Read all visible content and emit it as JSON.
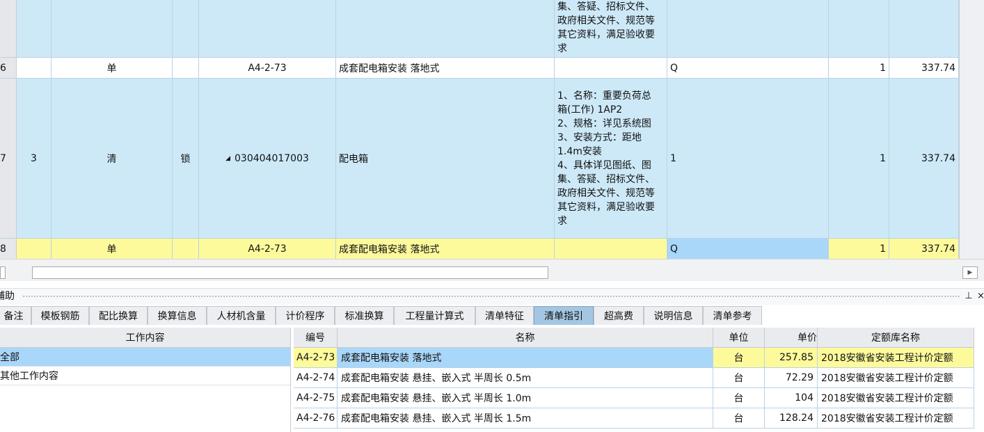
{
  "grid": {
    "rows": [
      {
        "row_no": "",
        "seq": "",
        "type": "",
        "lock": "",
        "code": "",
        "name": "",
        "feature": [
          "集、答疑、招标文件、",
          "政府相关文件、规范等",
          "其它资料，满足验收要",
          "求"
        ],
        "qty_expr": "",
        "qty": "",
        "price": "",
        "style": "blue"
      },
      {
        "row_no": "6",
        "seq": "",
        "type": "单",
        "lock": "",
        "code": "A4-2-73",
        "name": "成套配电箱安装 落地式",
        "feature": [],
        "qty_expr": "Q",
        "qty": "1",
        "price": "337.74",
        "style": "white"
      },
      {
        "row_no": "7",
        "seq": "3",
        "type": "清",
        "lock": "锁",
        "code": "030404017003",
        "name": "配电箱",
        "feature": [
          "1、名称：重要负荷总",
          "箱(工作) 1AP2",
          "2、规格：详见系统图",
          "3、安装方式：距地",
          "1.4m安装",
          "4、具体详见图纸、图",
          "集、答疑、招标文件、",
          "政府相关文件、规范等",
          "其它资料，满足验收要",
          "求"
        ],
        "qty_expr": "1",
        "qty": "1",
        "price": "337.74",
        "style": "blue"
      },
      {
        "row_no": "8",
        "seq": "",
        "type": "单",
        "lock": "",
        "code": "A4-2-73",
        "name": "成套配电箱安装 落地式",
        "feature": [],
        "qty_expr": "Q",
        "qty": "1",
        "price": "337.74",
        "style": "yellow"
      }
    ]
  },
  "aux_panel": {
    "title": "辅助",
    "pin_icon": "pin-icon",
    "close_icon": "close-icon"
  },
  "tabs": [
    {
      "label": "备注"
    },
    {
      "label": "模板钢筋"
    },
    {
      "label": "配比换算"
    },
    {
      "label": "换算信息"
    },
    {
      "label": "人材机含量"
    },
    {
      "label": "计价程序"
    },
    {
      "label": "标准换算"
    },
    {
      "label": "工程量计算式"
    },
    {
      "label": "清单特征"
    },
    {
      "label": "清单指引",
      "active": true
    },
    {
      "label": "超高费"
    },
    {
      "label": "说明信息"
    },
    {
      "label": "清单参考"
    }
  ],
  "work_content": {
    "header": "工作内容",
    "items": [
      "全部",
      "其他工作内容"
    ]
  },
  "ref_table": {
    "headers": [
      "编号",
      "名称",
      "单位",
      "单价",
      "定额库名称"
    ],
    "rows": [
      {
        "code": "A4-2-73",
        "name": "成套配电箱安装 落地式",
        "unit": "台",
        "price": "257.85",
        "lib": "2018安徽省安装工程计价定额"
      },
      {
        "code": "A4-2-74",
        "name": "成套配电箱安装 悬挂、嵌入式 半周长 0.5m",
        "unit": "台",
        "price": "72.29",
        "lib": "2018安徽省安装工程计价定额"
      },
      {
        "code": "A4-2-75",
        "name": "成套配电箱安装 悬挂、嵌入式 半周长 1.0m",
        "unit": "台",
        "price": "104",
        "lib": "2018安徽省安装工程计价定额"
      },
      {
        "code": "A4-2-76",
        "name": "成套配电箱安装 悬挂、嵌入式 半周长 1.5m",
        "unit": "台",
        "price": "128.24",
        "lib": "2018安徽省安装工程计价定额"
      }
    ]
  }
}
